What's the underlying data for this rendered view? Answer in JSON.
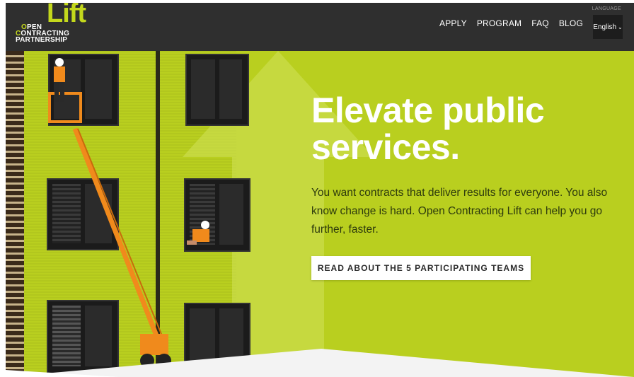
{
  "logo": {
    "wordmark": "Lift",
    "line1_o": "O",
    "line1_rest": "PEN",
    "line2_o": "C",
    "line2_rest": "ONTRACTING",
    "line3": "PARTNERSHIP"
  },
  "nav": {
    "items": [
      {
        "label": "APPLY"
      },
      {
        "label": "PROGRAM"
      },
      {
        "label": "FAQ"
      },
      {
        "label": "BLOG"
      }
    ]
  },
  "language": {
    "label": "LANGUAGE",
    "selected": "English"
  },
  "hero": {
    "headline_line1": "Elevate public",
    "headline_line2": "services.",
    "subtext": "You want contracts that deliver results for everyone. You also know change is hard. Open Contracting Lift can help you go further, faster.",
    "cta_label": "READ ABOUT THE 5 PARTICIPATING TEAMS"
  },
  "colors": {
    "brand_green": "#b9cf1f",
    "header_bg": "#2f2f2f",
    "logo_green": "#c4d81c",
    "boom_orange": "#f08a1c"
  },
  "icons": {
    "language_dropdown": "chevron-down-icon"
  }
}
